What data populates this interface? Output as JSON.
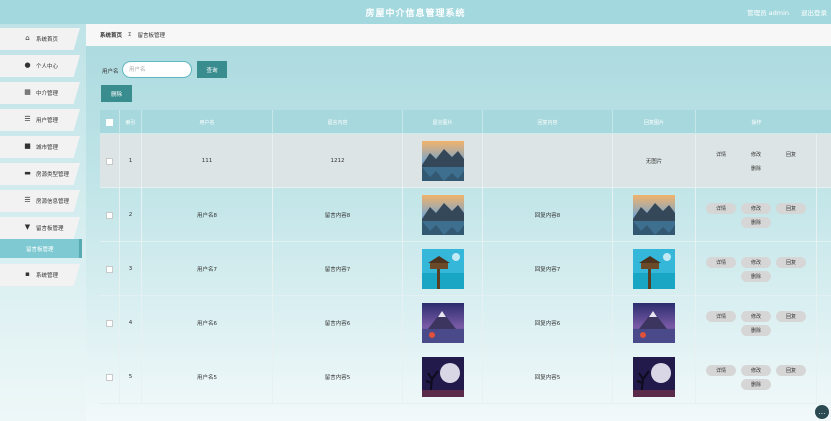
{
  "header": {
    "title": "房屋中介信息管理系统",
    "user_label": "管理员 admin",
    "logout_label": "退出登录"
  },
  "sidebar": {
    "items": [
      {
        "label": "系统首页",
        "icon": "home-icon",
        "glyph": "⌂"
      },
      {
        "label": "个人中心",
        "icon": "user-icon",
        "glyph": "●"
      },
      {
        "label": "中介管理",
        "icon": "grid-icon",
        "glyph": "▦"
      },
      {
        "label": "用户管理",
        "icon": "list-icon",
        "glyph": "☰"
      },
      {
        "label": "城市管理",
        "icon": "building-icon",
        "glyph": "■"
      },
      {
        "label": "房源类型管理",
        "icon": "folder-icon",
        "glyph": "▬"
      },
      {
        "label": "房源信息管理",
        "icon": "list-icon",
        "glyph": "☰"
      },
      {
        "label": "留言板管理",
        "icon": "tag-icon",
        "glyph": "▼"
      },
      {
        "label": "留言板管理",
        "icon": "",
        "glyph": "",
        "active": true
      },
      {
        "label": "系统管理",
        "icon": "apps-icon",
        "glyph": "▪"
      }
    ]
  },
  "breadcrumb": {
    "home": "系统首页",
    "separator": "Σ",
    "current": "留言板管理"
  },
  "search": {
    "label": "用户名",
    "placeholder": "用户名",
    "button": "查询"
  },
  "actions": {
    "delete_label": "删除"
  },
  "table": {
    "headers": [
      "",
      "索引",
      "用户名",
      "留言内容",
      "留言图片",
      "回复内容",
      "回复图片",
      "操作"
    ],
    "rows": [
      {
        "index": "1",
        "username": "111",
        "content": "1212",
        "reply": "",
        "reply_image": "无图片",
        "image": "mountain-lake"
      },
      {
        "index": "2",
        "username": "用户名8",
        "content": "留言内容8",
        "reply": "回复内容8",
        "reply_image": "",
        "image": "mountain-lake"
      },
      {
        "index": "3",
        "username": "用户名7",
        "content": "留言内容7",
        "reply": "回复内容7",
        "reply_image": "",
        "image": "tropical-pier"
      },
      {
        "index": "4",
        "username": "用户名6",
        "content": "留言内容6",
        "reply": "回复内容6",
        "reply_image": "",
        "image": "purple-mountain"
      },
      {
        "index": "5",
        "username": "用户名5",
        "content": "留言内容5",
        "reply": "回复内容5",
        "reply_image": "",
        "image": "moon-tree"
      }
    ],
    "op_labels": {
      "detail": "详情",
      "edit": "修改",
      "reply": "回复",
      "delete": "删除"
    }
  },
  "colors": {
    "header_bg": "#a3d8de",
    "button_bg": "#3a8d8f",
    "table_header_bg": "#a7d8dd",
    "active_menu": "#7fcad2"
  }
}
